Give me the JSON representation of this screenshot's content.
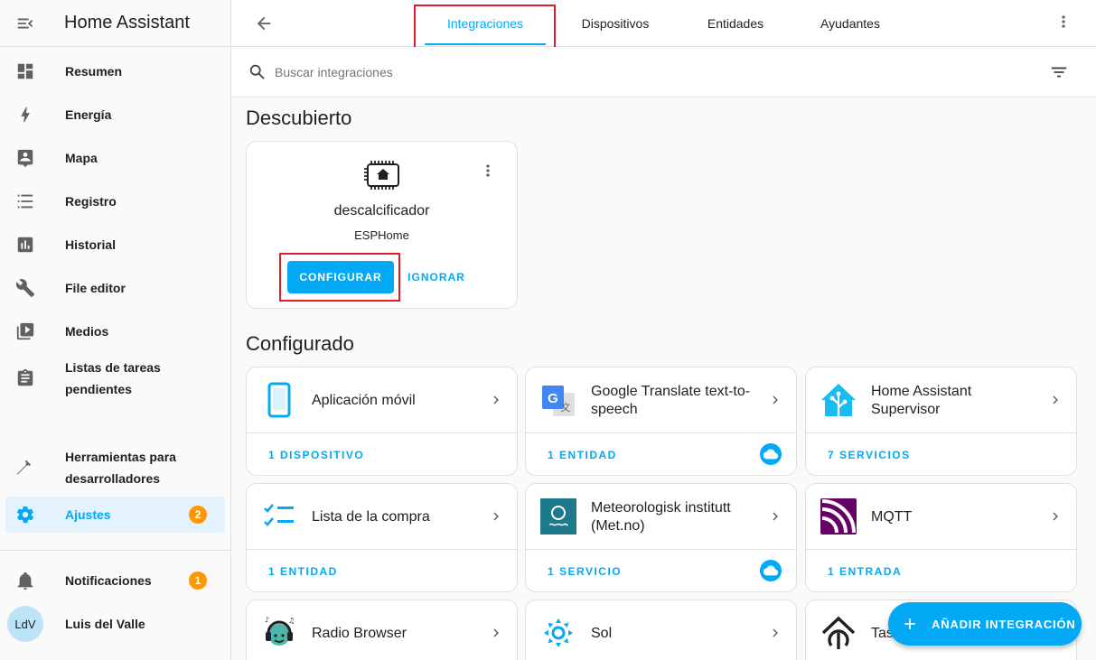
{
  "sidebar": {
    "title": "Home Assistant",
    "items": [
      {
        "label": "Resumen"
      },
      {
        "label": "Energía"
      },
      {
        "label": "Mapa"
      },
      {
        "label": "Registro"
      },
      {
        "label": "Historial"
      },
      {
        "label": "File editor"
      },
      {
        "label": "Medios"
      },
      {
        "label": "Listas de tareas pendientes"
      },
      {
        "label": "Herramientas para desarrolladores"
      },
      {
        "label": "Ajustes",
        "badge": "2"
      }
    ],
    "notifications": {
      "label": "Notificaciones",
      "badge": "1"
    },
    "user": {
      "initials": "LdV",
      "name": "Luis del Valle"
    }
  },
  "tabs": [
    {
      "label": "Integraciones"
    },
    {
      "label": "Dispositivos"
    },
    {
      "label": "Entidades"
    },
    {
      "label": "Ayudantes"
    }
  ],
  "search": {
    "placeholder": "Buscar integraciones"
  },
  "discovered": {
    "title": "Descubierto",
    "name": "descalcificador",
    "source": "ESPHome",
    "configure_label": "CONFIGURAR",
    "ignore_label": "IGNORAR"
  },
  "configured": {
    "title": "Configurado",
    "cards": [
      {
        "name": "Aplicación móvil",
        "footer": "1 DISPOSITIVO"
      },
      {
        "name": "Google Translate text-to-speech",
        "footer": "1 ENTIDAD"
      },
      {
        "name": "Home Assistant Supervisor",
        "footer": "7 SERVICIOS"
      },
      {
        "name": "Lista de la compra",
        "footer": "1 ENTIDAD"
      },
      {
        "name": "Meteorologisk institutt (Met.no)",
        "footer": "1 SERVICIO"
      },
      {
        "name": "MQTT",
        "footer": "1 ENTRADA"
      },
      {
        "name": "Radio Browser"
      },
      {
        "name": "Sol"
      },
      {
        "name": "Tas"
      }
    ]
  },
  "fab": {
    "label": "AÑADIR INTEGRACIÓN"
  },
  "colors": {
    "accent": "#03a9f4",
    "badge": "#ff9800",
    "highlight": "#e01b24"
  }
}
